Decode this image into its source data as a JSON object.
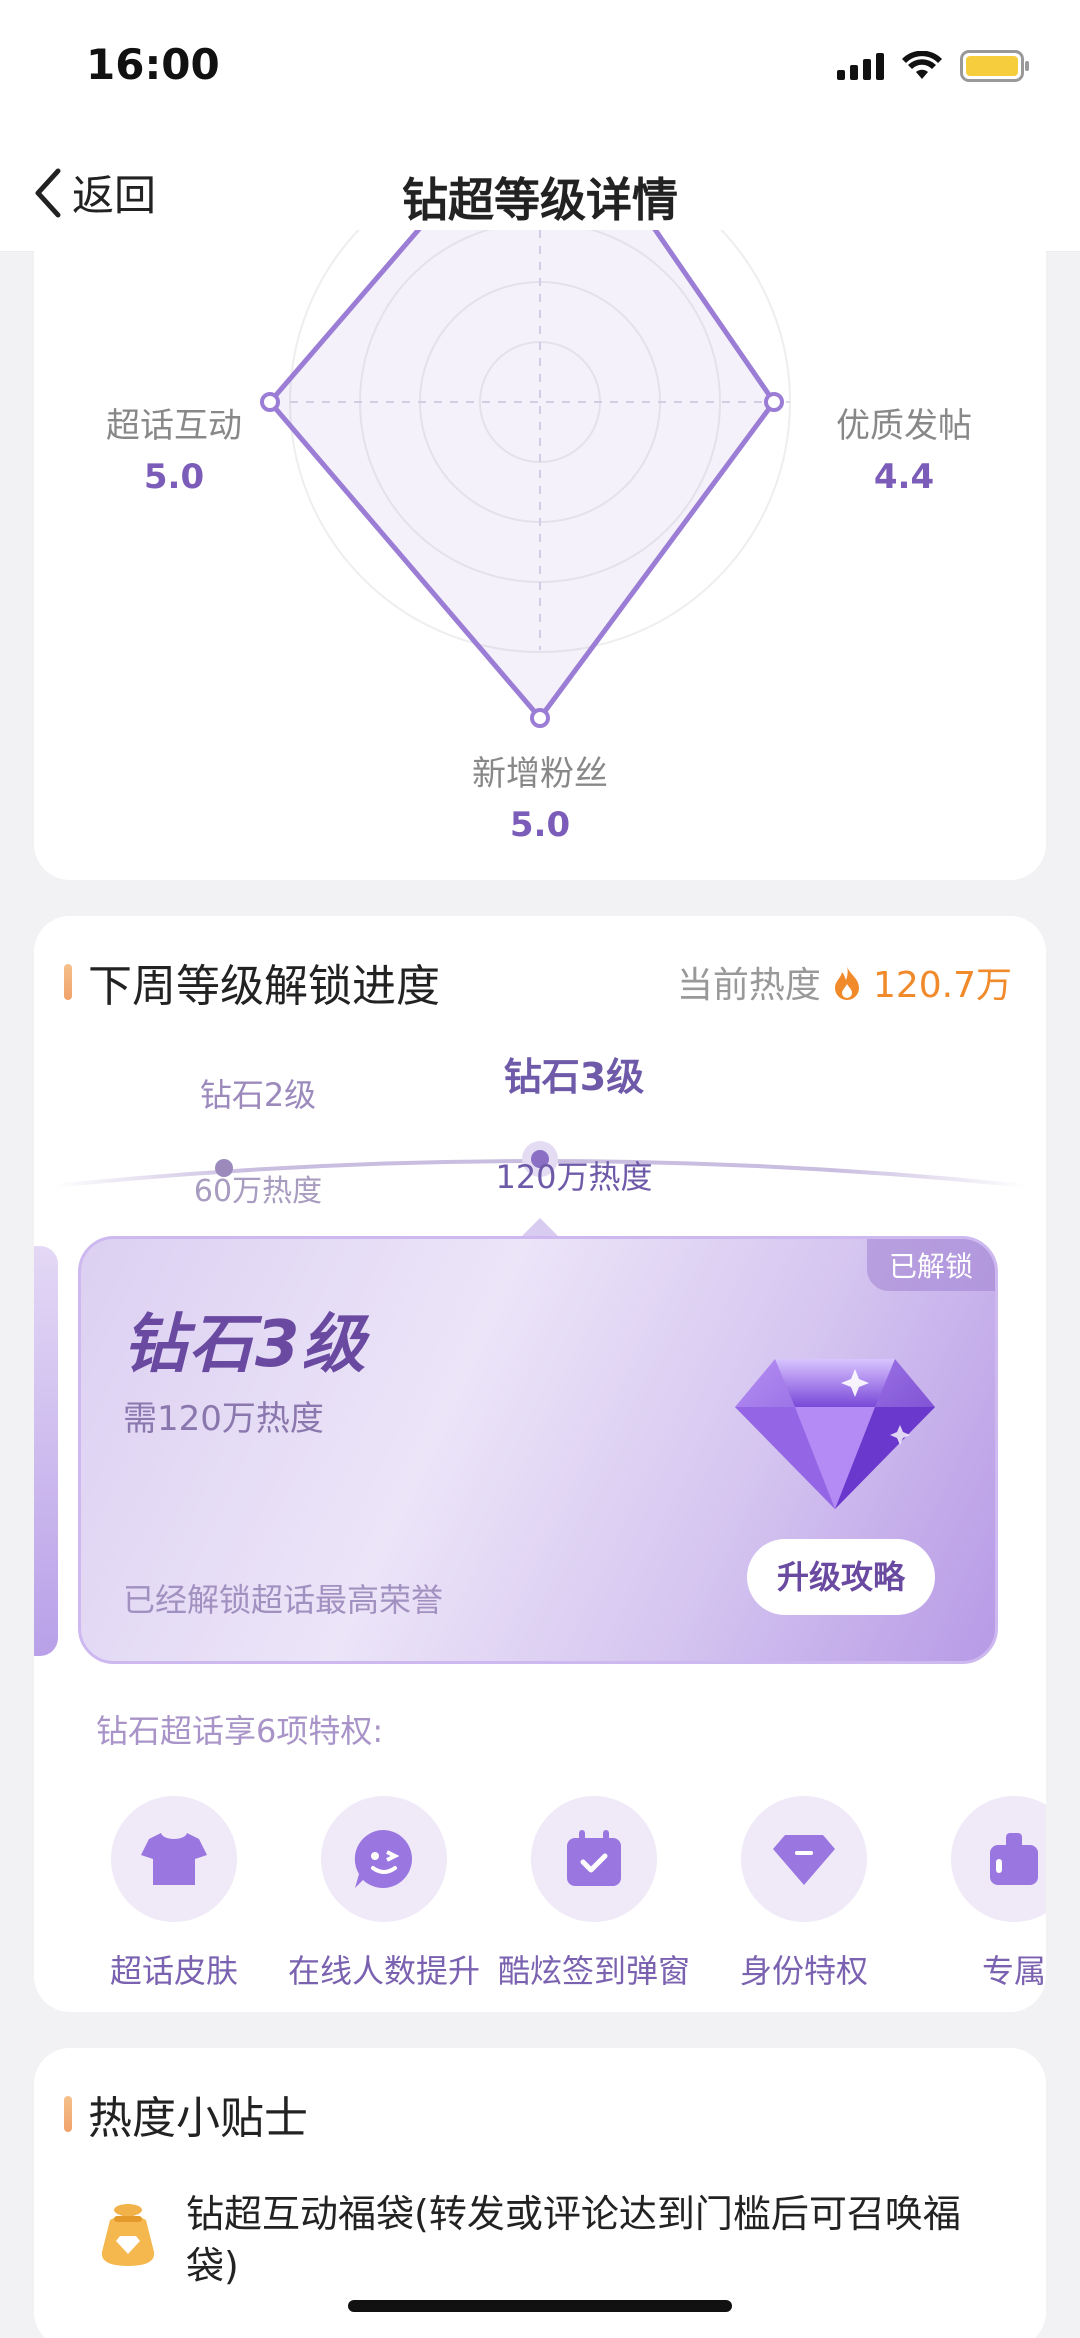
{
  "status_bar": {
    "time": "16:00"
  },
  "nav": {
    "back_label": "返回",
    "title": "钻超等级详情"
  },
  "radar": {
    "axes": [
      {
        "name": "超话互动",
        "value": "5.0"
      },
      {
        "name": "优质发帖",
        "value": "4.4"
      },
      {
        "name": "新增粉丝",
        "value": "5.0"
      }
    ]
  },
  "progress": {
    "section_title": "下周等级解锁进度",
    "heat_label": "当前热度",
    "heat_value": "120.7万",
    "levels": [
      {
        "name": "钻石2级",
        "heat": "60万热度"
      },
      {
        "name": "钻石3级",
        "heat": "120万热度"
      }
    ],
    "banner": {
      "tag": "已解锁",
      "title": "钻石3级",
      "need": "需120万热度",
      "desc": "已经解锁超话最高荣誉",
      "button": "升级攻略"
    },
    "perk_caption": "钻石超话享6项特权:",
    "perks": [
      {
        "label": "超话皮肤",
        "icon": "shirt-icon"
      },
      {
        "label": "在线人数提升",
        "icon": "chat-bubble-icon"
      },
      {
        "label": "酷炫签到弹窗",
        "icon": "calendar-check-icon"
      },
      {
        "label": "身份特权",
        "icon": "diamond-badge-icon"
      },
      {
        "label": "专属",
        "icon": "exclusive-icon"
      }
    ]
  },
  "tips": {
    "section_title": "热度小贴士",
    "items": [
      {
        "text": "钻超互动福袋(转发或评论达到门槛后可召唤福袋)",
        "icon": "lucky-bag-icon"
      }
    ]
  },
  "colors": {
    "accent": "#7b5cb8",
    "heat": "#f08a2a",
    "panel": "#efe9f8"
  }
}
